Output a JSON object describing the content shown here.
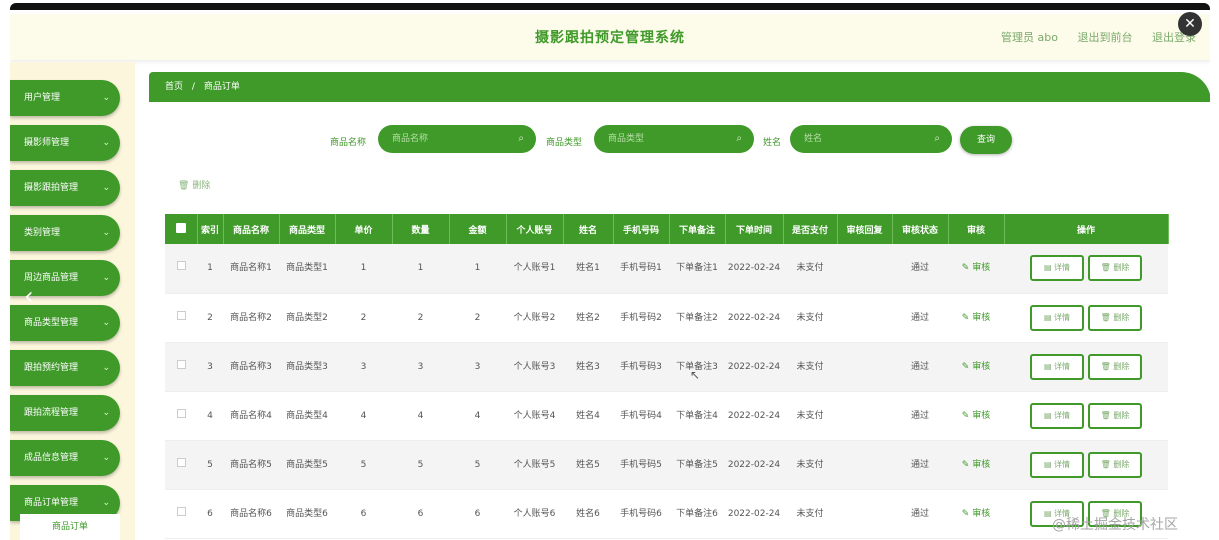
{
  "header": {
    "title": "摄影跟拍预定管理系统",
    "user": "管理员 abo",
    "back_front": "退出到前台",
    "logout": "退出登录"
  },
  "sidebar": {
    "items": [
      {
        "label": "用户管理"
      },
      {
        "label": "摄影师管理"
      },
      {
        "label": "摄影跟拍管理"
      },
      {
        "label": "类别管理"
      },
      {
        "label": "周边商品管理"
      },
      {
        "label": "商品类型管理"
      },
      {
        "label": "跟拍预约管理"
      },
      {
        "label": "跟拍流程管理"
      },
      {
        "label": "成品信息管理"
      },
      {
        "label": "商品订单管理"
      }
    ],
    "submenu": "商品订单"
  },
  "breadcrumb": {
    "home": "首页",
    "sep": "/",
    "current": "商品订单"
  },
  "search": {
    "name_label": "商品名称",
    "name_placeholder": "商品名称",
    "type_label": "商品类型",
    "type_placeholder": "商品类型",
    "person_label": "姓名",
    "person_placeholder": "姓名",
    "query_label": "查询"
  },
  "toolbar": {
    "delete_label": "删除"
  },
  "table": {
    "headers": [
      "索引",
      "商品名称",
      "商品类型",
      "单价",
      "数量",
      "金额",
      "个人账号",
      "姓名",
      "手机号码",
      "下单备注",
      "下单时间",
      "是否支付",
      "审核回复",
      "审核状态",
      "审核",
      "操作"
    ],
    "rows": [
      {
        "idx": "1",
        "name": "商品名称1",
        "type": "商品类型1",
        "price": "1",
        "qty": "1",
        "amount": "1",
        "account": "个人账号1",
        "person": "姓名1",
        "phone": "手机号码1",
        "remark": "下单备注1",
        "time": "2022-02-24",
        "paid": "未支付",
        "reply": "",
        "status": "通过",
        "audit": "审核",
        "detail": "详情",
        "del": "删除"
      },
      {
        "idx": "2",
        "name": "商品名称2",
        "type": "商品类型2",
        "price": "2",
        "qty": "2",
        "amount": "2",
        "account": "个人账号2",
        "person": "姓名2",
        "phone": "手机号码2",
        "remark": "下单备注2",
        "time": "2022-02-24",
        "paid": "未支付",
        "reply": "",
        "status": "通过",
        "audit": "审核",
        "detail": "详情",
        "del": "删除"
      },
      {
        "idx": "3",
        "name": "商品名称3",
        "type": "商品类型3",
        "price": "3",
        "qty": "3",
        "amount": "3",
        "account": "个人账号3",
        "person": "姓名3",
        "phone": "手机号码3",
        "remark": "下单备注3",
        "time": "2022-02-24",
        "paid": "未支付",
        "reply": "",
        "status": "通过",
        "audit": "审核",
        "detail": "详情",
        "del": "删除"
      },
      {
        "idx": "4",
        "name": "商品名称4",
        "type": "商品类型4",
        "price": "4",
        "qty": "4",
        "amount": "4",
        "account": "个人账号4",
        "person": "姓名4",
        "phone": "手机号码4",
        "remark": "下单备注4",
        "time": "2022-02-24",
        "paid": "未支付",
        "reply": "",
        "status": "通过",
        "audit": "审核",
        "detail": "详情",
        "del": "删除"
      },
      {
        "idx": "5",
        "name": "商品名称5",
        "type": "商品类型5",
        "price": "5",
        "qty": "5",
        "amount": "5",
        "account": "个人账号5",
        "person": "姓名5",
        "phone": "手机号码5",
        "remark": "下单备注5",
        "time": "2022-02-24",
        "paid": "未支付",
        "reply": "",
        "status": "通过",
        "audit": "审核",
        "detail": "详情",
        "del": "删除"
      },
      {
        "idx": "6",
        "name": "商品名称6",
        "type": "商品类型6",
        "price": "6",
        "qty": "6",
        "amount": "6",
        "account": "个人账号6",
        "person": "姓名6",
        "phone": "手机号码6",
        "remark": "下单备注6",
        "time": "2022-02-24",
        "paid": "未支付",
        "reply": "",
        "status": "通过",
        "audit": "审核",
        "detail": "详情",
        "del": "删除"
      }
    ]
  },
  "watermark": "@稀土掘金技术社区",
  "colors": {
    "accent": "#3f9a2a",
    "sidebar_bg": "#fcf6dc",
    "header_bg": "#fdfbea"
  }
}
